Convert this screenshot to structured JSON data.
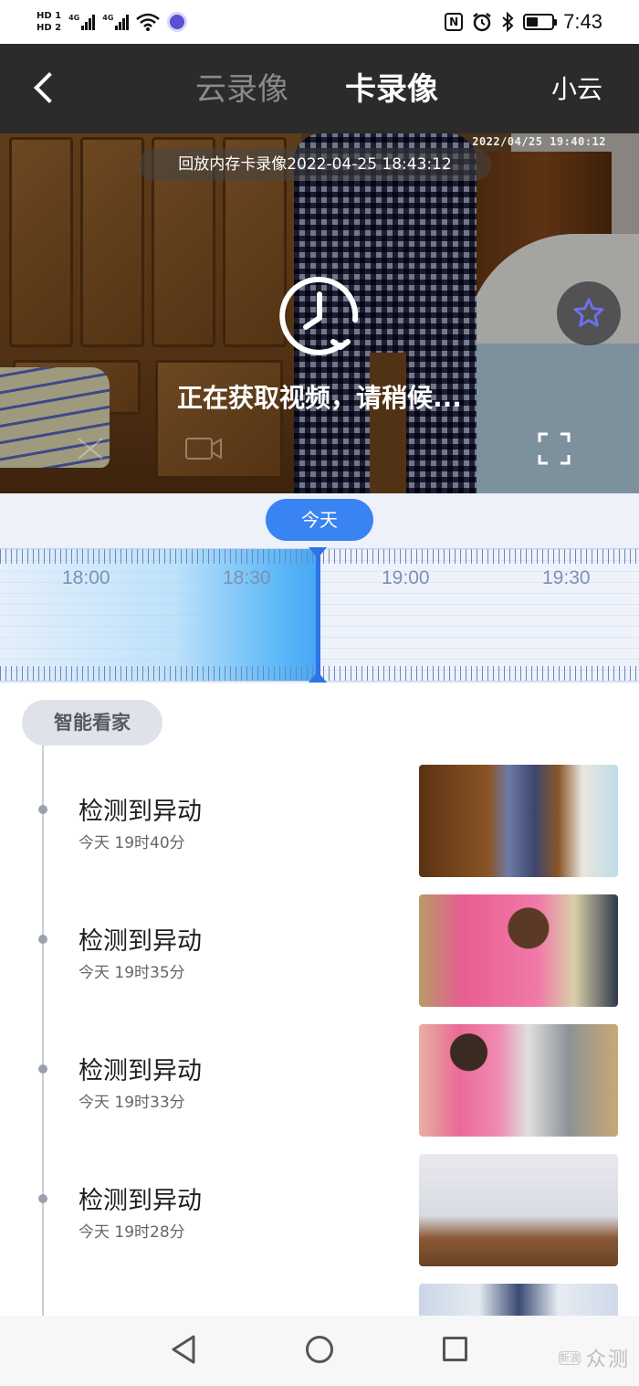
{
  "status_bar": {
    "hd1": "HD 1",
    "hd2": "HD 2",
    "net1": "4G",
    "net2": "4G",
    "nfc": "N",
    "time": "7:43"
  },
  "header": {
    "tab_cloud": "云录像",
    "tab_card": "卡录像",
    "right_label": "小云"
  },
  "video": {
    "playback_label": "回放内存卡录像2022-04-25 18:43:12",
    "osd_timestamp": "2022/04/25  19:40:12",
    "loading_text": "正在获取视频，请稍候..."
  },
  "timeline": {
    "today_label": "今天",
    "hour_labels": [
      "18:00",
      "18:30",
      "19:00",
      "19:30"
    ]
  },
  "events": {
    "section_label": "智能看家",
    "items": [
      {
        "title": "检测到异动",
        "time": "今天 19时40分"
      },
      {
        "title": "检测到异动",
        "time": "今天 19时35分"
      },
      {
        "title": "检测到异动",
        "time": "今天 19时33分"
      },
      {
        "title": "检测到异动",
        "time": "今天 19时28分"
      }
    ]
  },
  "watermark": {
    "badge": "新浪",
    "text": "众测"
  },
  "colors": {
    "accent": "#3a83f2",
    "header_bg": "#2b2b2b",
    "timeline_bg": "#edf1fa",
    "favorite_star": "#5b5bd6"
  },
  "icons": {
    "back": "chevron-left-icon",
    "loading": "clock-refresh-icon",
    "favorite": "star-icon",
    "fullscreen": "fullscreen-icon"
  }
}
